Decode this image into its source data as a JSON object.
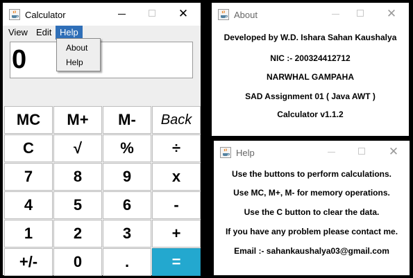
{
  "calculator": {
    "title": "Calculator",
    "menus": [
      "View",
      "Edit",
      "Help"
    ],
    "help_menu_items": [
      "About",
      "Help"
    ],
    "display_value": "0",
    "keys": [
      [
        "MC",
        "M+",
        "M-",
        "Back"
      ],
      [
        "C",
        "√",
        "%",
        "÷"
      ],
      [
        "7",
        "8",
        "9",
        "x"
      ],
      [
        "4",
        "5",
        "6",
        "-"
      ],
      [
        "1",
        "2",
        "3",
        "+"
      ],
      [
        "+/-",
        "0",
        ".",
        "="
      ]
    ],
    "equals_color": "#23a8cf"
  },
  "about": {
    "title": "About",
    "lines": [
      "Developed by W.D. Ishara Sahan Kaushalya",
      "NIC :- 200324412712",
      "NARWHAL GAMPAHA",
      "SAD Assignment 01 ( Java  AWT  )",
      "Calculator v1.1.2"
    ]
  },
  "help": {
    "title": "Help",
    "lines": [
      "Use the buttons to perform calculations.",
      "Use MC, M+, M- for memory operations.",
      "Use the C button to clear the data.",
      "If you have any problem please contact me.",
      "Email :- sahankaushalya03@gmail.com"
    ]
  },
  "icons": {
    "window_icon": "java-cup-icon",
    "minimize": "minimize-icon",
    "maximize": "maximize-icon",
    "close": "close-icon"
  }
}
